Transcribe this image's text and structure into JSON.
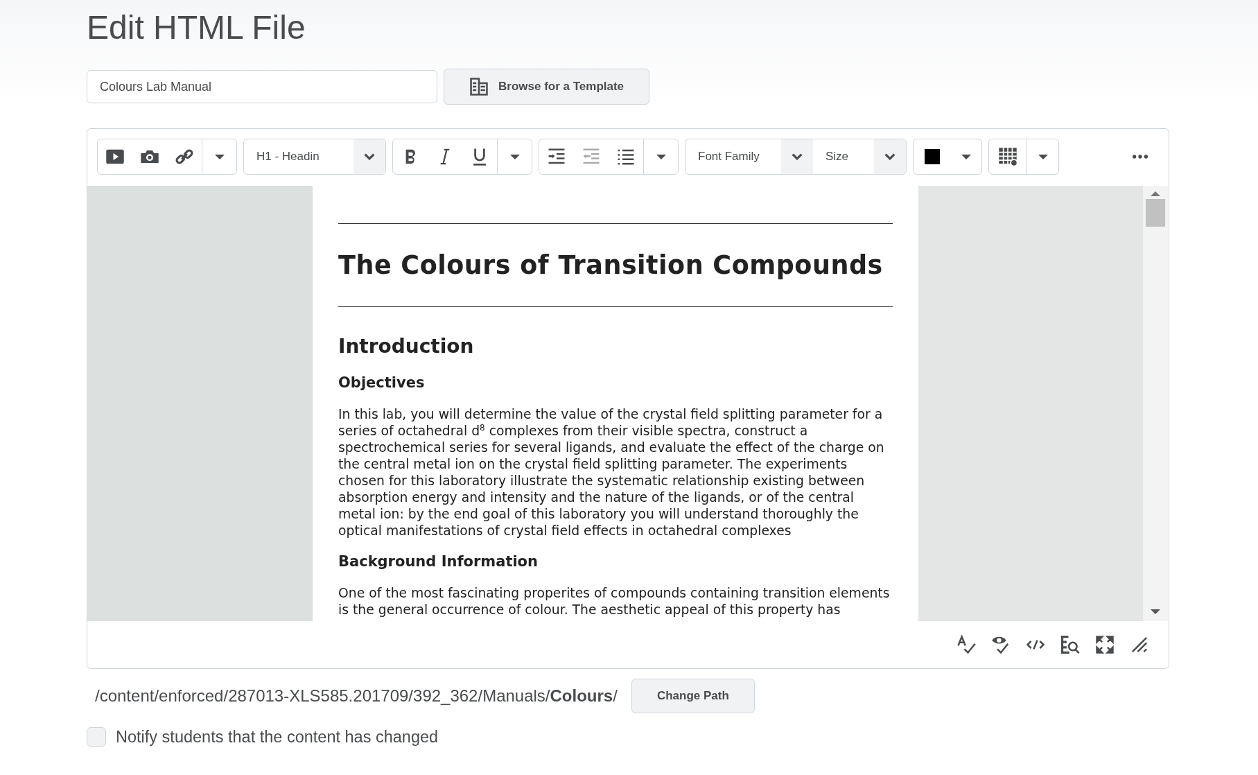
{
  "page": {
    "title": "Edit HTML File"
  },
  "title_field": {
    "value": "Colours Lab Manual"
  },
  "template_button": {
    "label": "Browse for a Template"
  },
  "toolbar": {
    "block_format": {
      "value": "H1 - Headin"
    },
    "outdent": {
      "disabled": true
    },
    "font_family": {
      "placeholder": "Font Family"
    },
    "font_size": {
      "placeholder": "Size"
    },
    "text_color": {
      "color": "#000000"
    }
  },
  "document": [
    {
      "kind": "rule"
    },
    {
      "kind": "h1",
      "text": "The Colours of Transition Compounds"
    },
    {
      "kind": "rule"
    },
    {
      "kind": "h2",
      "text": "Introduction"
    },
    {
      "kind": "h3",
      "text": "Objectives"
    },
    {
      "kind": "p",
      "text": "In this lab, you will determine the value of the crystal field splitting parameter for a series of octahedral d$^{8}$ complexes from their visible spectra, construct a spectrochemical series for several ligands, and evaluate the effect of the charge on the central metal ion on the crystal field splitting parameter. The experiments chosen for this laboratory illustrate the systematic relationship existing between absorption energy and intensity and the nature of the ligands, or of the central metal ion: by the end goal of this laboratory you will understand thoroughly the optical manifestations of crystal field effects in octahedral complexes"
    },
    {
      "kind": "h3",
      "text": "Background Information"
    },
    {
      "kind": "p",
      "text": "One of the most fascinating properites of compounds containing transition elements is the general occurrence of colour. The aesthetic appeal of this property has"
    }
  ],
  "path": {
    "text": "/content/enforced/287013-XLS585.201709/392_362/Manuals/**Colours**/"
  },
  "change_path_button": {
    "label": "Change Path"
  },
  "notify": {
    "label": "Notify students that the content has changed",
    "checked": false
  }
}
